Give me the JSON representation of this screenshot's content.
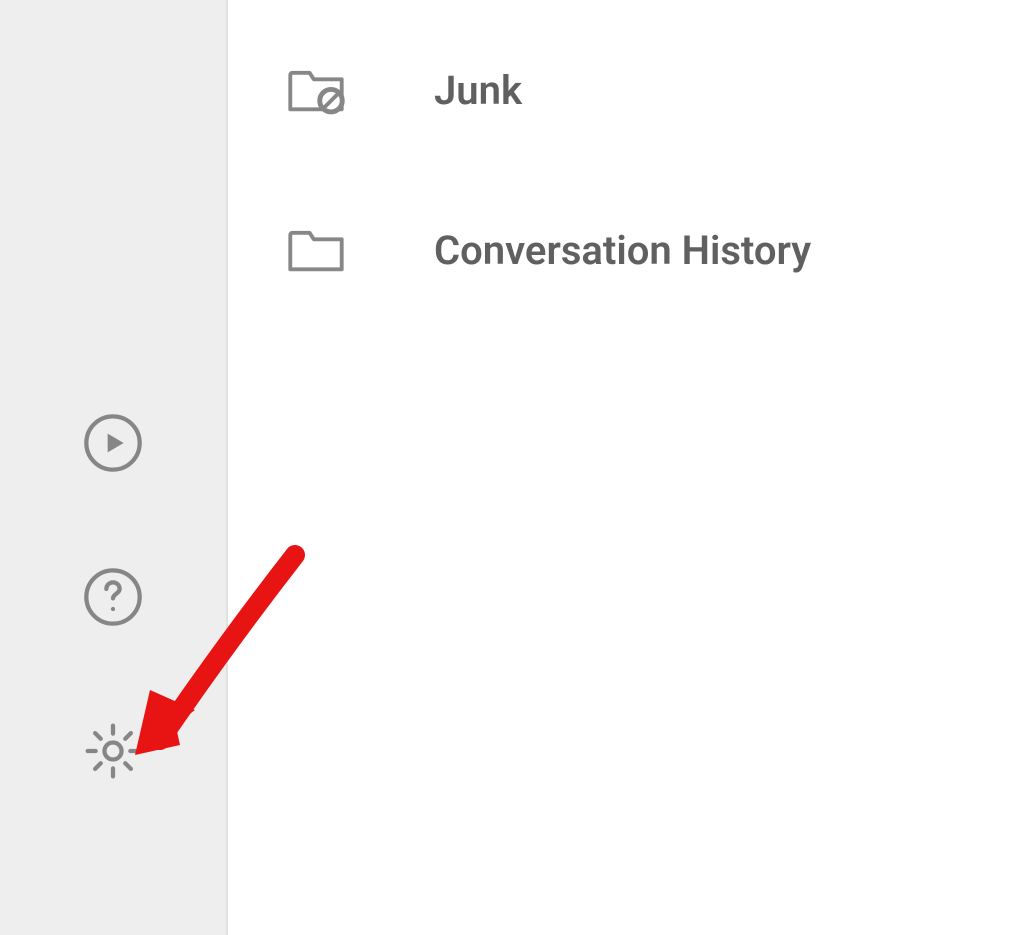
{
  "folders": [
    {
      "label": "Junk",
      "icon": "folder-junk"
    },
    {
      "label": "Conversation History",
      "icon": "folder"
    }
  ],
  "sidebar_icons": {
    "play": "play-circle-icon",
    "help": "help-circle-icon",
    "settings": "gear-icon"
  }
}
